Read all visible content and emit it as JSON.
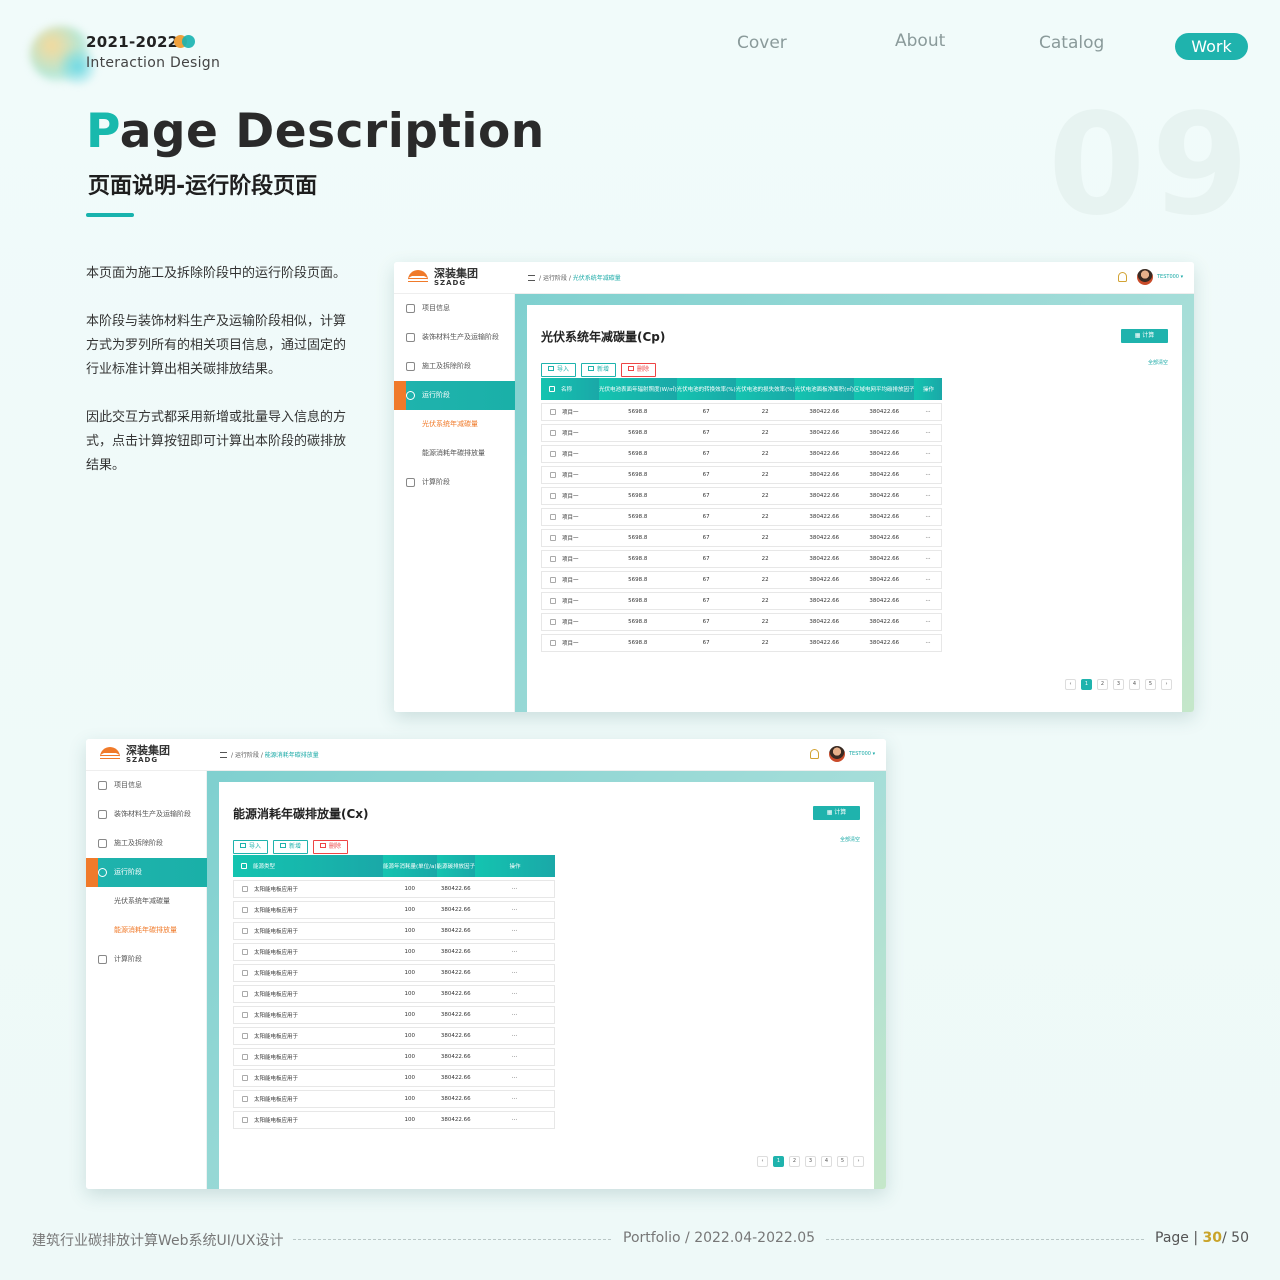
{
  "header": {
    "year": "2021-2022",
    "subtitle": "Interaction Design",
    "nav": [
      "Cover",
      "About",
      "Catalog",
      "Work"
    ],
    "active_nav": "Work"
  },
  "title": {
    "first_letter": "P",
    "rest": "age Description",
    "cn": "页面说明-运行阶段页面",
    "page_number_bg": "09"
  },
  "description": [
    "本页面为施工及拆除阶段中的运行阶段页面。",
    "本阶段与装饰材料生产及运输阶段相似，计算方式为罗列所有的相关项目信息，通过固定的行业标准计算出相关碳排放结果。",
    "因此交互方式都采用新增或批量导入信息的方式，点击计算按钮即可计算出本阶段的碳排放结果。"
  ],
  "app": {
    "logo_cn": "深装集团",
    "logo_en": "SZADG",
    "user": "TEST000 ▾",
    "sidebar": [
      "项目信息",
      "装饰材料生产及运输阶段",
      "施工及拆除阶段",
      "运行阶段",
      "光伏系统年减碳量",
      "能源消耗年碳排放量",
      "计算阶段"
    ],
    "calc_label": "计算",
    "clear_all": "全部清空",
    "import_label": "导入",
    "add_label": "新增",
    "delete_label": "删除",
    "pages": [
      "‹",
      "1",
      "2",
      "3",
      "4",
      "5",
      "›"
    ]
  },
  "screen1": {
    "crumb_parent": "运行阶段",
    "crumb_current": "光伏系统年减碳量",
    "title": "光伏系统年减碳量(Cp)",
    "columns": [
      "名称",
      "光伏电池表面年辐射照度(W/㎡)",
      "光伏电池的转换效率(%)",
      "光伏电池的损失效率(%)",
      "光伏电池面板净面积(㎡)",
      "区域电网平均碳排放因子",
      "操作"
    ],
    "row": [
      "项目一",
      "5698.8",
      "67",
      "22",
      "380422.66",
      "380422.66",
      "···"
    ],
    "row_count": 12
  },
  "screen2": {
    "crumb_parent": "运行阶段",
    "crumb_current": "能源消耗年碳排放量",
    "title": "能源消耗年碳排放量(Cx)",
    "columns": [
      "能源类型",
      "能源年消耗量(单位/a)",
      "能源碳排放因子",
      "操作"
    ],
    "row": [
      "太阳能电板应用于",
      "100",
      "380422.66",
      "···"
    ],
    "row_count": 12
  },
  "footer": {
    "left": "建筑行业碳排放计算Web系统UI/UX设计",
    "center": "Portfolio / 2022.04-2022.05",
    "page_label": "Page",
    "page_current": "30",
    "page_total": "/ 50"
  }
}
